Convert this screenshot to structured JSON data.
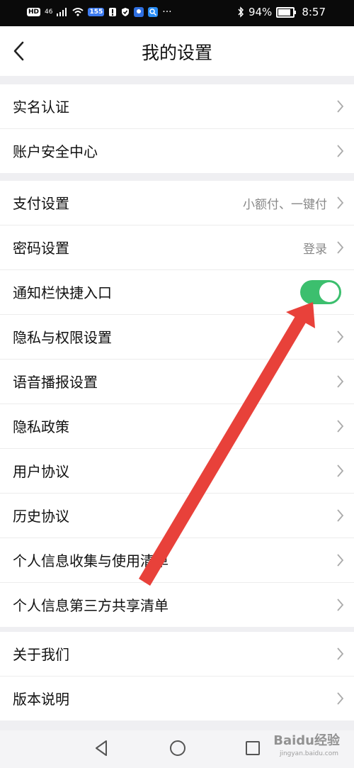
{
  "status_bar": {
    "left_labels": [
      "HD",
      "46",
      "155"
    ],
    "battery_percent_text": "94%",
    "battery_level": 0.94,
    "time": "8:57"
  },
  "header": {
    "title": "我的设置"
  },
  "sections": [
    {
      "rows": [
        {
          "label": "实名认证"
        },
        {
          "label": "账户安全中心"
        }
      ]
    },
    {
      "rows": [
        {
          "label": "支付设置",
          "value": "小额付、一键付"
        },
        {
          "label": "密码设置",
          "value": "登录"
        },
        {
          "label": "通知栏快捷入口",
          "toggle_on": true
        },
        {
          "label": "隐私与权限设置"
        },
        {
          "label": "语音播报设置"
        },
        {
          "label": "隐私政策"
        },
        {
          "label": "用户协议"
        },
        {
          "label": "历史协议"
        },
        {
          "label": "个人信息收集与使用清单"
        },
        {
          "label": "个人信息第三方共享清单"
        }
      ]
    },
    {
      "rows": [
        {
          "label": "关于我们"
        },
        {
          "label": "版本说明"
        }
      ]
    }
  ],
  "colors": {
    "toggle_on": "#3cbf6e",
    "annotation_arrow": "#e8413a"
  },
  "watermark": {
    "text": "Baidu经验",
    "sub": "jingyan.baidu.com"
  }
}
